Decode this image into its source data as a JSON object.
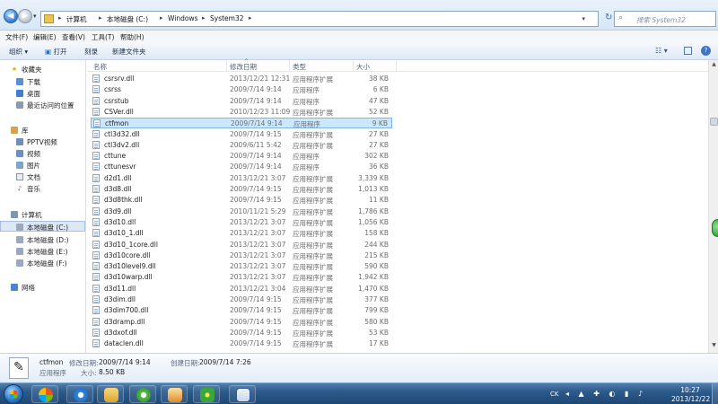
{
  "address": {
    "crumbs": [
      "计算机",
      "本地磁盘 (C:)",
      "Windows",
      "System32"
    ],
    "search_placeholder": "搜索 System32",
    "nav_drop": "▾",
    "sep": "▸",
    "addr_drop": "▾",
    "refresh_glyph": "↻"
  },
  "menu": [
    "文件(F)",
    "编辑(E)",
    "查看(V)",
    "工具(T)",
    "帮助(H)"
  ],
  "toolbar": {
    "organize": "组织 ▾",
    "open": "打开",
    "burn": "刻录",
    "new_folder": "新建文件夹",
    "view_glyph": "☷ ▾",
    "help_glyph": "?"
  },
  "nav": {
    "favorites": "收藏夹",
    "downloads": "下载",
    "desktop": "桌面",
    "recent": "最近访问的位置",
    "libraries": "库",
    "pptv": "PPTV视频",
    "videos": "视频",
    "pictures": "图片",
    "documents": "文档",
    "music": "音乐",
    "computer": "计算机",
    "drive_c": "本地磁盘 (C:)",
    "drive_d": "本地磁盘 (D:)",
    "drive_e": "本地磁盘 (E:)",
    "drive_f": "本地磁盘 (F:)",
    "network": "网络"
  },
  "columns": {
    "name": "名称",
    "modified": "修改日期",
    "type": "类型",
    "size": "大小",
    "sort_glyph": "^"
  },
  "files": [
    {
      "name": "csrsrv.dll",
      "date": "2013/12/21 12:31",
      "type": "应用程序扩展",
      "size": "38 KB"
    },
    {
      "name": "csrss",
      "date": "2009/7/14 9:14",
      "type": "应用程序",
      "size": "6 KB"
    },
    {
      "name": "csrstub",
      "date": "2009/7/14 9:14",
      "type": "应用程序",
      "size": "47 KB"
    },
    {
      "name": "CSVer.dll",
      "date": "2010/12/23 11:09",
      "type": "应用程序扩展",
      "size": "52 KB"
    },
    {
      "name": "ctfmon",
      "date": "2009/7/14 9:14",
      "type": "应用程序",
      "size": "9 KB"
    },
    {
      "name": "ctl3d32.dll",
      "date": "2009/7/14 9:15",
      "type": "应用程序扩展",
      "size": "27 KB"
    },
    {
      "name": "ctl3dv2.dll",
      "date": "2009/6/11 5:42",
      "type": "应用程序扩展",
      "size": "27 KB"
    },
    {
      "name": "cttune",
      "date": "2009/7/14 9:14",
      "type": "应用程序",
      "size": "302 KB"
    },
    {
      "name": "cttunesvr",
      "date": "2009/7/14 9:14",
      "type": "应用程序",
      "size": "36 KB"
    },
    {
      "name": "d2d1.dll",
      "date": "2013/12/21 3:07",
      "type": "应用程序扩展",
      "size": "3,339 KB"
    },
    {
      "name": "d3d8.dll",
      "date": "2009/7/14 9:15",
      "type": "应用程序扩展",
      "size": "1,013 KB"
    },
    {
      "name": "d3d8thk.dll",
      "date": "2009/7/14 9:15",
      "type": "应用程序扩展",
      "size": "11 KB"
    },
    {
      "name": "d3d9.dll",
      "date": "2010/11/21 5:29",
      "type": "应用程序扩展",
      "size": "1,786 KB"
    },
    {
      "name": "d3d10.dll",
      "date": "2013/12/21 3:07",
      "type": "应用程序扩展",
      "size": "1,056 KB"
    },
    {
      "name": "d3d10_1.dll",
      "date": "2013/12/21 3:07",
      "type": "应用程序扩展",
      "size": "158 KB"
    },
    {
      "name": "d3d10_1core.dll",
      "date": "2013/12/21 3:07",
      "type": "应用程序扩展",
      "size": "244 KB"
    },
    {
      "name": "d3d10core.dll",
      "date": "2013/12/21 3:07",
      "type": "应用程序扩展",
      "size": "215 KB"
    },
    {
      "name": "d3d10level9.dll",
      "date": "2013/12/21 3:07",
      "type": "应用程序扩展",
      "size": "590 KB"
    },
    {
      "name": "d3d10warp.dll",
      "date": "2013/12/21 3:07",
      "type": "应用程序扩展",
      "size": "1,942 KB"
    },
    {
      "name": "d3d11.dll",
      "date": "2013/12/21 3:04",
      "type": "应用程序扩展",
      "size": "1,470 KB"
    },
    {
      "name": "d3dim.dll",
      "date": "2009/7/14 9:15",
      "type": "应用程序扩展",
      "size": "377 KB"
    },
    {
      "name": "d3dim700.dll",
      "date": "2009/7/14 9:15",
      "type": "应用程序扩展",
      "size": "799 KB"
    },
    {
      "name": "d3dramp.dll",
      "date": "2009/7/14 9:15",
      "type": "应用程序扩展",
      "size": "580 KB"
    },
    {
      "name": "d3dxof.dll",
      "date": "2009/7/14 9:15",
      "type": "应用程序扩展",
      "size": "53 KB"
    },
    {
      "name": "dataclen.dll",
      "date": "2009/7/14 9:15",
      "type": "应用程序扩展",
      "size": "17 KB"
    }
  ],
  "details": {
    "filename": "ctfmon",
    "modified_label": "修改日期:",
    "modified_value": "2009/7/14 9:14",
    "created_label": "创建日期:",
    "created_value": "2009/7/14 7:26",
    "type": "应用程序",
    "size_label": "大小:",
    "size_value": "8.50 KB"
  },
  "taskbar": {
    "lang": "CK",
    "tray_glyphs": "◂ ▲ ✚ ◐ ▮ ♪",
    "time": "10:27",
    "date": "2013/12/22"
  },
  "scroll": {
    "up": "▲",
    "down": "▼"
  }
}
